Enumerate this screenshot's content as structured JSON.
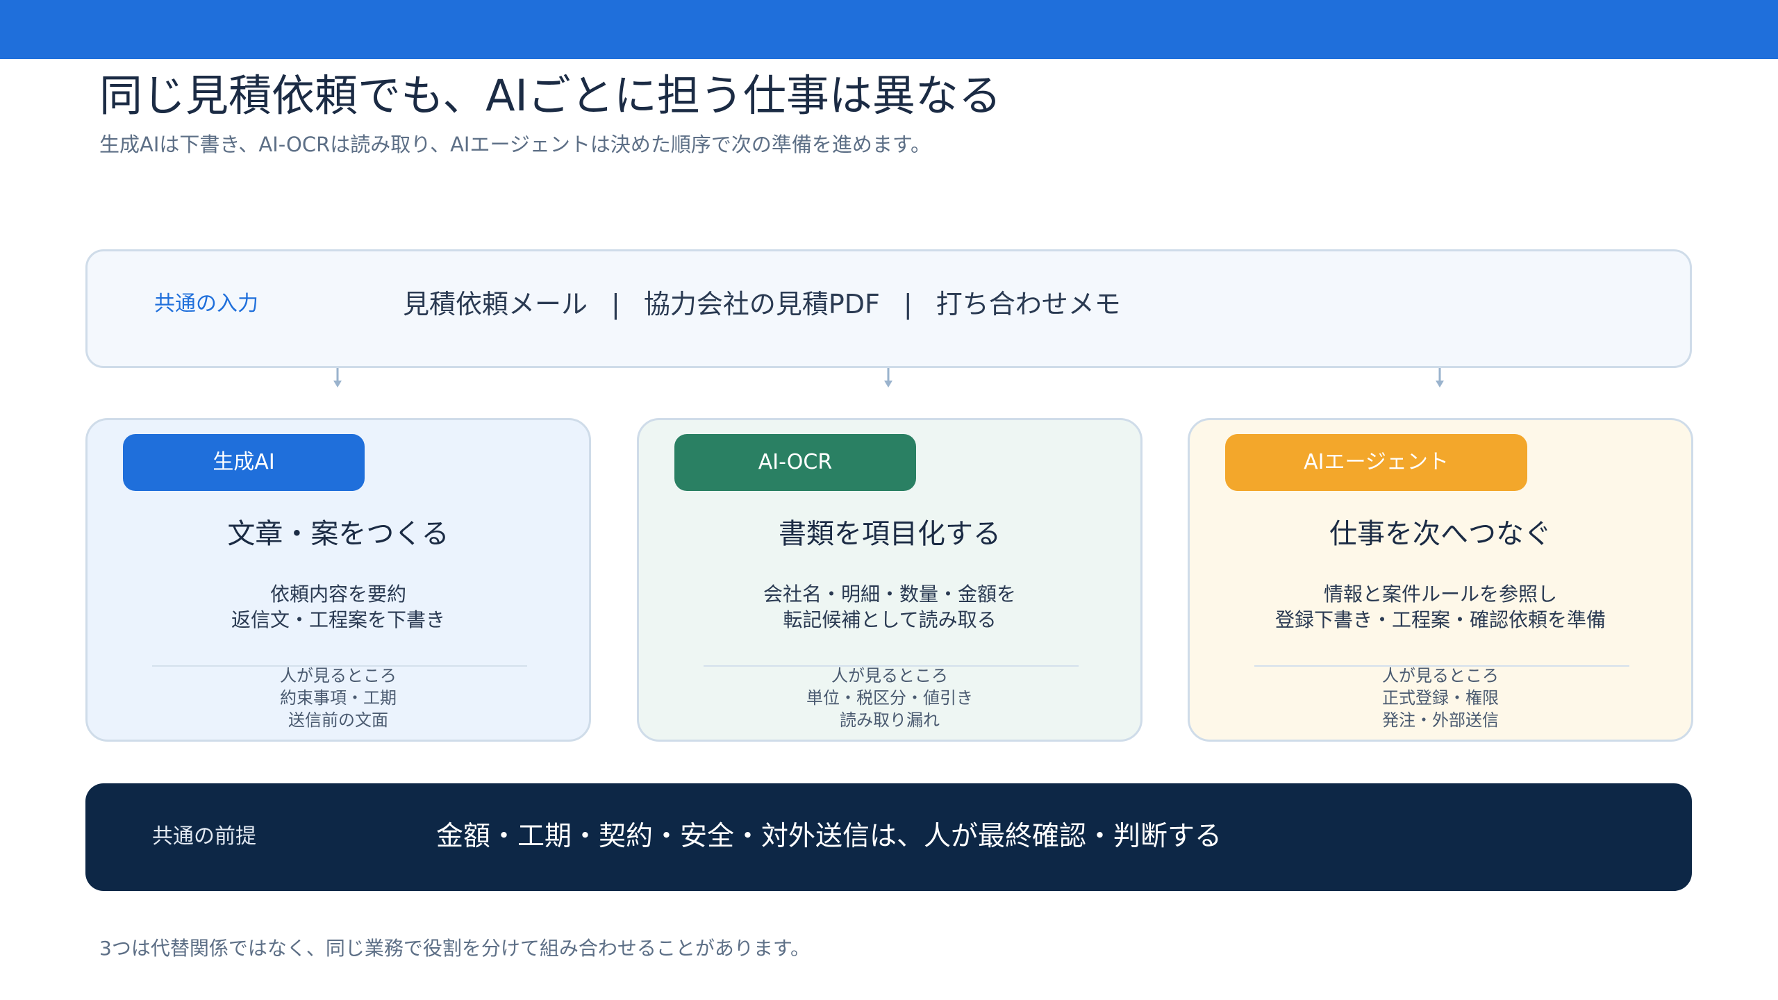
{
  "header": {
    "title": "同じ見積依頼でも、AIごとに担う仕事は異なる",
    "subtitle": "生成AIは下書き、AI-OCRは読み取り、AIエージェントは決めた順序で次の準備を進めます。"
  },
  "input": {
    "label": "共通の入力",
    "items": [
      "見積依頼メール",
      "協力会社の見積PDF",
      "打ち合わせメモ"
    ],
    "separator": "|"
  },
  "cards": [
    {
      "badge": "生成AI",
      "heading": "文章・案をつくる",
      "desc": [
        "依頼内容を要約",
        "返信文・工程案を下書き"
      ],
      "check": [
        "人が見るところ",
        "約束事項・工期",
        "送信前の文面"
      ]
    },
    {
      "badge": "AI-OCR",
      "heading": "書類を項目化する",
      "desc": [
        "会社名・明細・数量・金額を",
        "転記候補として読み取る"
      ],
      "check": [
        "人が見るところ",
        "単位・税区分・値引き",
        "読み取り漏れ"
      ]
    },
    {
      "badge": "AIエージェント",
      "heading": "仕事を次へつなぐ",
      "desc": [
        "情報と案件ルールを参照し",
        "登録下書き・工程案・確認依頼を準備"
      ],
      "check": [
        "人が見るところ",
        "正式登録・権限",
        "発注・外部送信"
      ]
    }
  ],
  "premise": {
    "label": "共通の前提",
    "text": "金額・工期・契約・安全・対外送信は、人が最終確認・判断する"
  },
  "footnote": "3つは代替関係ではなく、同じ業務で役割を分けて組み合わせることがあります。",
  "colors": {
    "topbar": "#1f6fdb",
    "generative_ai": "#1f6fdb",
    "ai_ocr": "#2a8063",
    "ai_agent": "#f3a72b",
    "premise_bg": "#0d2746"
  }
}
